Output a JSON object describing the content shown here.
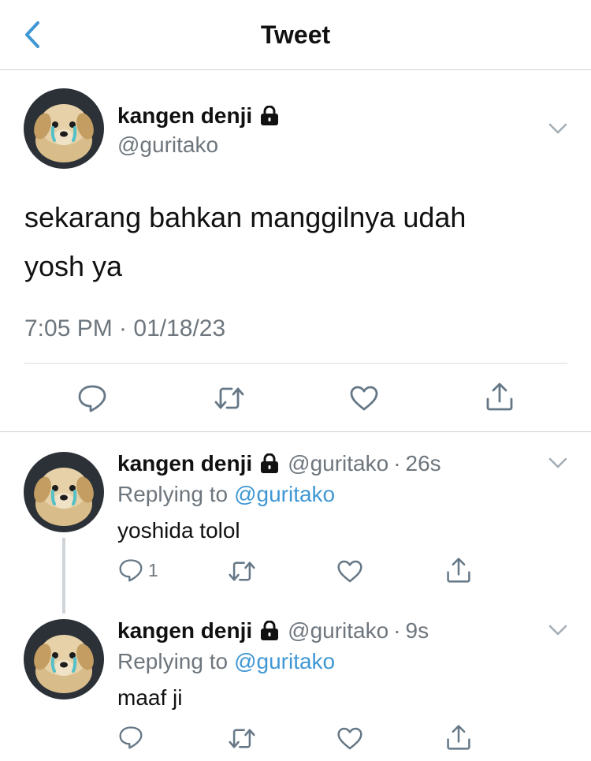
{
  "header": {
    "title": "Tweet"
  },
  "tweet": {
    "author_name": "kangen denji",
    "author_handle": "@guritako",
    "text_line1": "sekarang bahkan manggilnya udah",
    "text_line2": "yosh ya",
    "timestamp": "7:05 PM · 01/18/23"
  },
  "replies": [
    {
      "author_name": "kangen denji",
      "author_handle": "@guritako",
      "age": "26s",
      "replying_label": "Replying to",
      "replying_handle": "@guritako",
      "text": "yoshida tolol",
      "reply_count": "1"
    },
    {
      "author_name": "kangen denji",
      "author_handle": "@guritako",
      "age": "9s",
      "replying_label": "Replying to",
      "replying_handle": "@guritako",
      "text": "maaf ji",
      "reply_count": ""
    }
  ],
  "separator_dot": "·",
  "icons": [
    "back-chevron-icon",
    "lock-icon",
    "chevron-down-icon",
    "reply-icon",
    "retweet-icon",
    "like-icon",
    "share-icon"
  ],
  "colors": {
    "accent": "#3f97d4",
    "text": "#111111",
    "muted": "#6e767d",
    "divider": "#cfd4d9"
  }
}
